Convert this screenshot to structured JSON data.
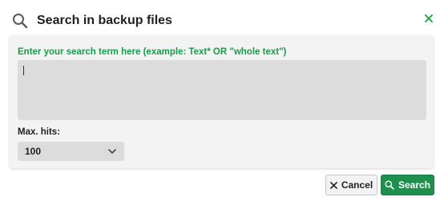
{
  "dialog": {
    "title": "Search in backup files",
    "search_label": "Enter your search term here (example: Text* OR \"whole text\")",
    "search_value": "",
    "max_hits_label": "Max. hits:",
    "max_hits_value": "100",
    "cancel_label": "Cancel",
    "search_button_label": "Search"
  },
  "icons": {
    "title": "search-icon",
    "close": "close-icon",
    "dropdown": "chevron-down-icon",
    "cancel": "close-icon",
    "search_button": "search-icon"
  },
  "colors": {
    "accent": "#1a9a4a",
    "primary_button": "#1f8f4e",
    "panel_background": "#f3f3f3",
    "field_background": "#dcdcdc"
  }
}
